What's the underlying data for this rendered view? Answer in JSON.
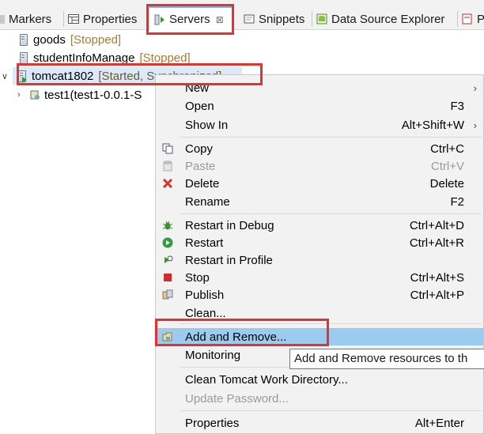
{
  "tabs": [
    {
      "label": "Markers",
      "icon": "markers-icon"
    },
    {
      "label": "Properties",
      "icon": "properties-icon"
    },
    {
      "label": "Servers",
      "icon": "servers-icon",
      "active": true
    },
    {
      "label": "Snippets",
      "icon": "snippets-icon"
    },
    {
      "label": "Data Source Explorer",
      "icon": "data-source-icon"
    },
    {
      "label": "Pr",
      "icon": "progress-icon"
    }
  ],
  "tree": [
    {
      "name": "goods",
      "status": "[Stopped]"
    },
    {
      "name": "studentInfoManage",
      "status": "[Stopped]"
    },
    {
      "name": "tomcat1802",
      "status": "[Started, Synchronized]",
      "expanded": true
    },
    {
      "name": "test1(test1-0.0.1-S"
    }
  ],
  "menu": {
    "new": "New",
    "open": "Open",
    "open_sc": "F3",
    "show_in": "Show In",
    "show_in_sc": "Alt+Shift+W",
    "copy": "Copy",
    "copy_sc": "Ctrl+C",
    "paste": "Paste",
    "paste_sc": "Ctrl+V",
    "delete": "Delete",
    "delete_sc": "Delete",
    "rename": "Rename",
    "rename_sc": "F2",
    "restart_debug": "Restart in Debug",
    "restart_debug_sc": "Ctrl+Alt+D",
    "restart": "Restart",
    "restart_sc": "Ctrl+Alt+R",
    "restart_profile": "Restart in Profile",
    "stop": "Stop",
    "stop_sc": "Ctrl+Alt+S",
    "publish": "Publish",
    "publish_sc": "Ctrl+Alt+P",
    "clean": "Clean...",
    "add_remove": "Add and Remove...",
    "monitoring": "Monitoring",
    "clean_tomcat": "Clean Tomcat Work Directory...",
    "update_password": "Update Password...",
    "properties": "Properties",
    "properties_sc": "Alt+Enter"
  },
  "tooltip": "Add and Remove resources to th",
  "colors": {
    "highlight": "#9ccbf0",
    "redbox": "#e2332f",
    "status": "#a27d34",
    "selection": "#dbe9f8"
  }
}
